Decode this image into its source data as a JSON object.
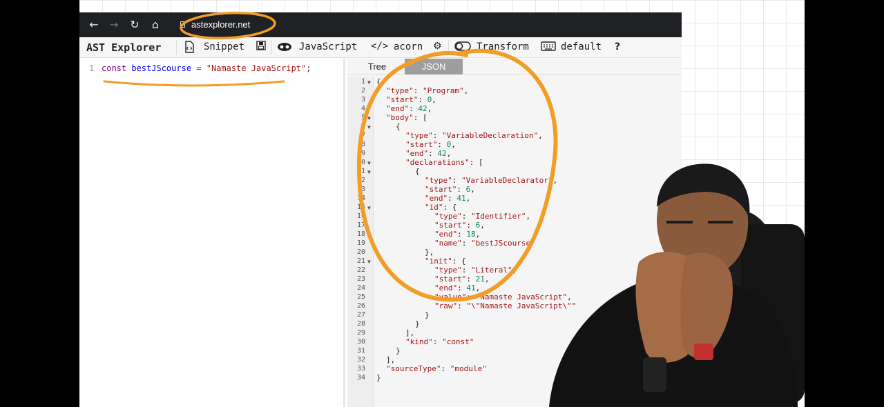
{
  "browser": {
    "url": "astexplorer.net"
  },
  "toolbar": {
    "app_title": "AST Explorer",
    "snippet_label": "Snippet",
    "language_label": "JavaScript",
    "parser_label": "acorn",
    "transform_label": "Transform",
    "keymap_label": "default",
    "help_label": "?"
  },
  "editor": {
    "line_number": "1",
    "code": {
      "keyword": "const",
      "identifier": "bestJScourse",
      "operator": " = ",
      "string": "\"Namaste JavaScript\"",
      "end": ";"
    }
  },
  "output": {
    "tabs": [
      {
        "label": "Tree",
        "active": false
      },
      {
        "label": "JSON",
        "active": true
      }
    ],
    "lines": [
      {
        "n": "1",
        "fold": true,
        "indent": 0,
        "k": "",
        "v": "",
        "t": "{"
      },
      {
        "n": "2",
        "fold": false,
        "indent": 1,
        "k": "\"type\"",
        "v": "\"Program\"",
        "t": ","
      },
      {
        "n": "3",
        "fold": false,
        "indent": 1,
        "k": "\"start\"",
        "v": "0",
        "t": ","
      },
      {
        "n": "4",
        "fold": false,
        "indent": 1,
        "k": "\"end\"",
        "v": "42",
        "t": ","
      },
      {
        "n": "5",
        "fold": true,
        "indent": 1,
        "k": "\"body\"",
        "v": "",
        "t": "["
      },
      {
        "n": "6",
        "fold": true,
        "indent": 2,
        "k": "",
        "v": "",
        "t": "{"
      },
      {
        "n": "7",
        "fold": false,
        "indent": 3,
        "k": "\"type\"",
        "v": "\"VariableDeclaration\"",
        "t": ","
      },
      {
        "n": "8",
        "fold": false,
        "indent": 3,
        "k": "\"start\"",
        "v": "0",
        "t": ","
      },
      {
        "n": "9",
        "fold": false,
        "indent": 3,
        "k": "\"end\"",
        "v": "42",
        "t": ","
      },
      {
        "n": "10",
        "fold": true,
        "indent": 3,
        "k": "\"declarations\"",
        "v": "",
        "t": "["
      },
      {
        "n": "11",
        "fold": true,
        "indent": 4,
        "k": "",
        "v": "",
        "t": "{"
      },
      {
        "n": "12",
        "fold": false,
        "indent": 5,
        "k": "\"type\"",
        "v": "\"VariableDeclarator\"",
        "t": ","
      },
      {
        "n": "13",
        "fold": false,
        "indent": 5,
        "k": "\"start\"",
        "v": "6",
        "t": ","
      },
      {
        "n": "14",
        "fold": false,
        "indent": 5,
        "k": "\"end\"",
        "v": "41",
        "t": ","
      },
      {
        "n": "15",
        "fold": true,
        "indent": 5,
        "k": "\"id\"",
        "v": "",
        "t": "{"
      },
      {
        "n": "16",
        "fold": false,
        "indent": 6,
        "k": "\"type\"",
        "v": "\"Identifier\"",
        "t": ","
      },
      {
        "n": "17",
        "fold": false,
        "indent": 6,
        "k": "\"start\"",
        "v": "6",
        "t": ","
      },
      {
        "n": "18",
        "fold": false,
        "indent": 6,
        "k": "\"end\"",
        "v": "18",
        "t": ","
      },
      {
        "n": "19",
        "fold": false,
        "indent": 6,
        "k": "\"name\"",
        "v": "\"bestJScourse\"",
        "t": ""
      },
      {
        "n": "20",
        "fold": false,
        "indent": 5,
        "k": "",
        "v": "",
        "t": "},"
      },
      {
        "n": "21",
        "fold": true,
        "indent": 5,
        "k": "\"init\"",
        "v": "",
        "t": "{"
      },
      {
        "n": "22",
        "fold": false,
        "indent": 6,
        "k": "\"type\"",
        "v": "\"Literal\"",
        "t": ","
      },
      {
        "n": "23",
        "fold": false,
        "indent": 6,
        "k": "\"start\"",
        "v": "21",
        "t": ","
      },
      {
        "n": "24",
        "fold": false,
        "indent": 6,
        "k": "\"end\"",
        "v": "41",
        "t": ","
      },
      {
        "n": "25",
        "fold": false,
        "indent": 6,
        "k": "\"value\"",
        "v": "\"Namaste JavaScript\"",
        "t": ","
      },
      {
        "n": "26",
        "fold": false,
        "indent": 6,
        "k": "\"raw\"",
        "v": "\"\\\"Namaste JavaScript\\\"\"",
        "t": ""
      },
      {
        "n": "27",
        "fold": false,
        "indent": 5,
        "k": "",
        "v": "",
        "t": "}"
      },
      {
        "n": "28",
        "fold": false,
        "indent": 4,
        "k": "",
        "v": "",
        "t": "}"
      },
      {
        "n": "29",
        "fold": false,
        "indent": 3,
        "k": "",
        "v": "",
        "t": "],"
      },
      {
        "n": "30",
        "fold": false,
        "indent": 3,
        "k": "\"kind\"",
        "v": "\"const\"",
        "t": ""
      },
      {
        "n": "31",
        "fold": false,
        "indent": 2,
        "k": "",
        "v": "",
        "t": "}"
      },
      {
        "n": "32",
        "fold": false,
        "indent": 1,
        "k": "",
        "v": "",
        "t": "],"
      },
      {
        "n": "33",
        "fold": false,
        "indent": 1,
        "k": "\"sourceType\"",
        "v": "\"module\"",
        "t": ""
      },
      {
        "n": "34",
        "fold": false,
        "indent": 0,
        "k": "",
        "v": "",
        "t": "}"
      }
    ]
  },
  "colors": {
    "annotation": "#f29d27",
    "chrome": "#202124",
    "active_tab": "#9e9e9e"
  }
}
